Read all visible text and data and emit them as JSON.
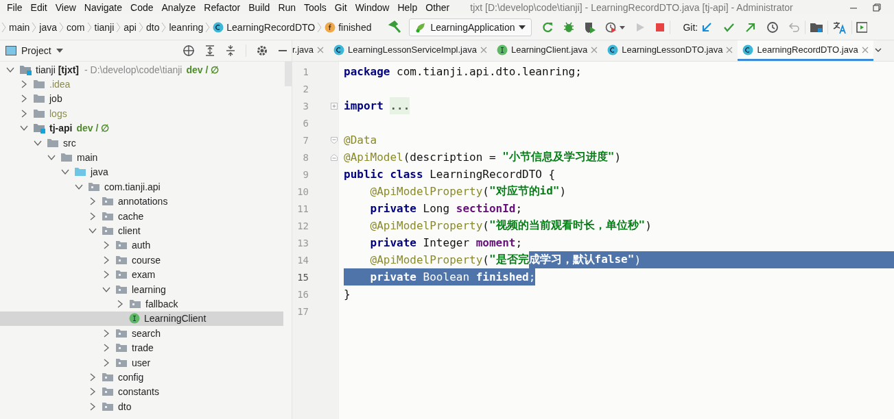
{
  "menu": [
    "File",
    "Edit",
    "View",
    "Navigate",
    "Code",
    "Analyze",
    "Refactor",
    "Build",
    "Run",
    "Tools",
    "Git",
    "Window",
    "Help",
    "Other"
  ],
  "window": {
    "title": "tjxt [D:\\develop\\code\\tianji] - LearningRecordDTO.java [tj-api] - Administrator"
  },
  "breadcrumb": [
    {
      "label": "main",
      "kind": "folder"
    },
    {
      "label": "java",
      "kind": "folder"
    },
    {
      "label": "com",
      "kind": "folder"
    },
    {
      "label": "tianji",
      "kind": "folder"
    },
    {
      "label": "api",
      "kind": "folder"
    },
    {
      "label": "dto",
      "kind": "folder"
    },
    {
      "label": "leanring",
      "kind": "folder"
    },
    {
      "label": "LearningRecordDTO",
      "kind": "class"
    },
    {
      "label": "finished",
      "kind": "field"
    }
  ],
  "run_config": {
    "label": "LearningApplication"
  },
  "git_label": "Git:",
  "project_panel": {
    "title": "Project"
  },
  "tree": [
    {
      "label": "tianji **[tjxt]**",
      "kind": "project",
      "hint": "- D:\\develop\\code\\tianji",
      "vcs": "dev / ∅",
      "expanded": true,
      "selected": false,
      "children": [
        {
          "label": ".idea",
          "kind": "folder",
          "ignored": true,
          "expanded": false,
          "selected": false
        },
        {
          "label": "job",
          "kind": "folder",
          "expanded": false,
          "selected": false
        },
        {
          "label": "logs",
          "kind": "folder",
          "ignored": true,
          "expanded": false,
          "selected": false
        },
        {
          "label": "tj-api",
          "kind": "module",
          "vcs": "dev / ∅",
          "expanded": true,
          "selected": false,
          "children": [
            {
              "label": "src",
              "kind": "folder",
              "expanded": true,
              "selected": false,
              "children": [
                {
                  "label": "main",
                  "kind": "folder",
                  "expanded": true,
                  "selected": false,
                  "children": [
                    {
                      "label": "java",
                      "kind": "source",
                      "expanded": true,
                      "selected": false,
                      "children": [
                        {
                          "label": "com.tianji.api",
                          "kind": "package",
                          "expanded": true,
                          "selected": false,
                          "children": [
                            {
                              "label": "annotations",
                              "kind": "package",
                              "expanded": false,
                              "selected": false
                            },
                            {
                              "label": "cache",
                              "kind": "package",
                              "expanded": false,
                              "selected": false
                            },
                            {
                              "label": "client",
                              "kind": "package",
                              "expanded": true,
                              "selected": false,
                              "children": [
                                {
                                  "label": "auth",
                                  "kind": "package",
                                  "expanded": false,
                                  "selected": false
                                },
                                {
                                  "label": "course",
                                  "kind": "package",
                                  "expanded": false,
                                  "selected": false
                                },
                                {
                                  "label": "exam",
                                  "kind": "package",
                                  "expanded": false,
                                  "selected": false
                                },
                                {
                                  "label": "learning",
                                  "kind": "package",
                                  "expanded": true,
                                  "selected": false,
                                  "children": [
                                    {
                                      "label": "fallback",
                                      "kind": "package",
                                      "expanded": false,
                                      "selected": false
                                    },
                                    {
                                      "label": "LearningClient",
                                      "kind": "interface",
                                      "selected": true
                                    }
                                  ]
                                },
                                {
                                  "label": "search",
                                  "kind": "package",
                                  "expanded": false,
                                  "selected": false
                                },
                                {
                                  "label": "trade",
                                  "kind": "package",
                                  "expanded": false,
                                  "selected": false
                                },
                                {
                                  "label": "user",
                                  "kind": "package",
                                  "expanded": false,
                                  "selected": false
                                }
                              ]
                            },
                            {
                              "label": "config",
                              "kind": "package",
                              "expanded": false,
                              "selected": false
                            },
                            {
                              "label": "constants",
                              "kind": "package",
                              "expanded": false,
                              "selected": false
                            },
                            {
                              "label": "dto",
                              "kind": "package",
                              "expanded": false,
                              "selected": false
                            }
                          ]
                        }
                      ]
                    }
                  ]
                }
              ]
            }
          ]
        }
      ]
    }
  ],
  "editor_tabs": [
    {
      "label": "r.java",
      "kind": "file",
      "selected": false
    },
    {
      "label": "LearningLessonServiceImpl.java",
      "kind": "class",
      "selected": false
    },
    {
      "label": "LearningClient.java",
      "kind": "interface",
      "selected": false
    },
    {
      "label": "LearningLessonDTO.java",
      "kind": "class",
      "selected": false
    },
    {
      "label": "LearningRecordDTO.java",
      "kind": "class",
      "selected": true
    }
  ],
  "code": [
    {
      "number": "1",
      "kind": "plain",
      "tokens": [
        {
          "text": "package",
          "kind": "keyword",
          "selected": false
        },
        {
          "text": " com.tianji.api.dto.leanring;",
          "kind": "plain",
          "selected": false
        }
      ]
    },
    {
      "number": "2",
      "kind": "plain"
    },
    {
      "number": "3",
      "kind": "fold-collapsed",
      "tokens": [
        {
          "text": "import ",
          "kind": "keyword",
          "selected": false
        },
        {
          "text": "...",
          "kind": "folded",
          "selected": false
        }
      ]
    },
    {
      "number": "6",
      "kind": "plain"
    },
    {
      "number": "7",
      "kind": "fold-start",
      "tokens": [
        {
          "text": "@Data",
          "kind": "annotation",
          "selected": false
        }
      ]
    },
    {
      "number": "8",
      "kind": "fold-end",
      "tokens": [
        {
          "text": "@ApiModel",
          "kind": "annotation",
          "selected": false
        },
        {
          "text": "(description = ",
          "kind": "plain",
          "selected": false
        },
        {
          "text": "\"小节信息及学习进度\"",
          "kind": "string",
          "selected": false
        },
        {
          "text": ")",
          "kind": "plain",
          "selected": false
        }
      ]
    },
    {
      "number": "9",
      "kind": "plain",
      "tokens": [
        {
          "text": "public class",
          "kind": "keyword",
          "selected": false
        },
        {
          "text": " LearningRecordDTO {",
          "kind": "plain",
          "selected": false
        }
      ]
    },
    {
      "number": "10",
      "kind": "plain",
      "tokens": [
        {
          "text": "    @ApiModelProperty",
          "kind": "annotation",
          "selected": false
        },
        {
          "text": "(",
          "kind": "plain",
          "selected": false
        },
        {
          "text": "\"对应节的id\"",
          "kind": "string",
          "selected": false
        },
        {
          "text": ")",
          "kind": "plain",
          "selected": false
        }
      ]
    },
    {
      "number": "11",
      "kind": "plain",
      "tokens": [
        {
          "text": "    private",
          "kind": "keyword",
          "selected": false
        },
        {
          "text": " Long ",
          "kind": "plain",
          "selected": false
        },
        {
          "text": "sectionId",
          "kind": "field",
          "selected": false
        },
        {
          "text": ";",
          "kind": "plain",
          "selected": false
        }
      ]
    },
    {
      "number": "12",
      "kind": "plain",
      "tokens": [
        {
          "text": "    @ApiModelProperty",
          "kind": "annotation",
          "selected": false
        },
        {
          "text": "(",
          "kind": "plain",
          "selected": false
        },
        {
          "text": "\"视频的当前观看时长，单位秒\"",
          "kind": "string",
          "selected": false
        },
        {
          "text": ")",
          "kind": "plain",
          "selected": false
        }
      ]
    },
    {
      "number": "13",
      "kind": "plain",
      "tokens": [
        {
          "text": "    private",
          "kind": "keyword",
          "selected": false
        },
        {
          "text": " Integer ",
          "kind": "plain",
          "selected": false
        },
        {
          "text": "moment",
          "kind": "field",
          "selected": false
        },
        {
          "text": ";",
          "kind": "plain",
          "selected": false
        }
      ]
    },
    {
      "number": "14",
      "kind": "plain",
      "selected_eol": true,
      "tokens": [
        {
          "text": "    @ApiModelProperty",
          "kind": "annotation",
          "selected": false
        },
        {
          "text": "(",
          "kind": "plain",
          "selected": false
        },
        {
          "text": "\"是否完",
          "kind": "string",
          "selected": false
        },
        {
          "text": "成学习，默认false\"",
          "kind": "string",
          "selected": true
        },
        {
          "text": ")",
          "kind": "plain",
          "selected": true
        }
      ]
    },
    {
      "number": "15",
      "kind": "plain",
      "current": true,
      "tokens": [
        {
          "text": "    private",
          "kind": "keyword",
          "selected": true
        },
        {
          "text": " Boolean ",
          "kind": "plain",
          "selected": true
        },
        {
          "text": "finished",
          "kind": "field",
          "selected": true
        },
        {
          "text": ";",
          "kind": "plain",
          "selected": true
        }
      ]
    },
    {
      "number": "16",
      "kind": "plain",
      "tokens": [
        {
          "text": "}",
          "kind": "plain",
          "selected": false
        }
      ]
    },
    {
      "number": "17",
      "kind": "plain"
    }
  ]
}
